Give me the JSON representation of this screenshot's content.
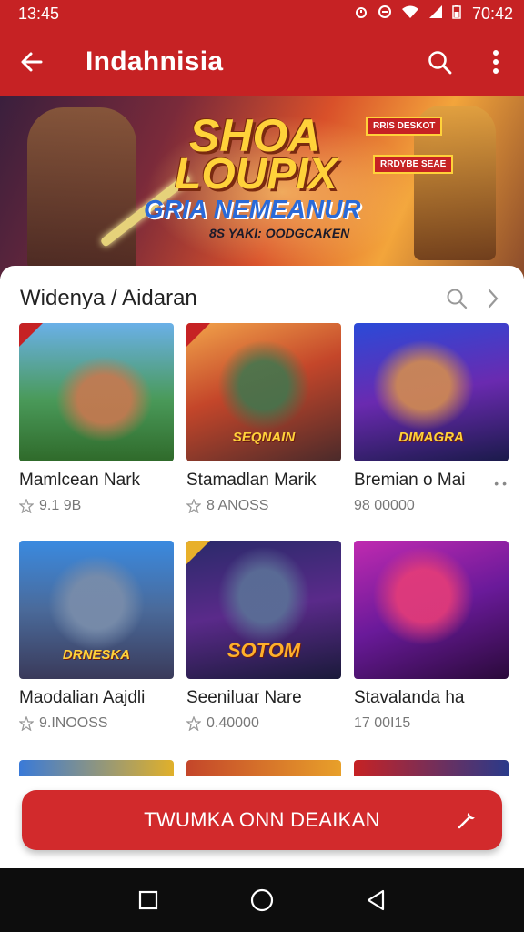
{
  "status_bar": {
    "time_left": "13:45",
    "time_right": "70:42",
    "icons": [
      "alarm-icon",
      "dnd-icon",
      "wifi-icon",
      "signal-icon",
      "battery-icon"
    ]
  },
  "app_bar": {
    "title": "Indahnisia",
    "back_icon": "arrow-left-icon",
    "search_icon": "search-icon",
    "menu_icon": "more-vert-icon"
  },
  "banner": {
    "title_line1": "SHOA",
    "title_line2": "LOUPIX",
    "subtitle": "GRIA NEMEANUR",
    "tagline": "8S YAKI: OODGCAKEN",
    "badge1": "RRIS DESKOT",
    "badge2": "RRDYBE SEAE"
  },
  "section": {
    "title": "Widenya / Aidaran",
    "search_icon": "search-icon",
    "next_icon": "chevron-right-icon"
  },
  "games": [
    {
      "name": "Mamlcean Nark",
      "rating": "9.1 9B",
      "logo": "",
      "art": "forest"
    },
    {
      "name": "Stamadlan Marik",
      "rating": "8 ANOSS",
      "logo": "SEQNAIN",
      "art": "city"
    },
    {
      "name": "Bremian o Mai",
      "rating": "98 00000",
      "logo": "DIMAGRA",
      "art": "space"
    },
    {
      "name": "Maodalian Aajdli",
      "rating": "9.INOOSS",
      "logo": "DRNESKA",
      "art": "castle"
    },
    {
      "name": "Seeniluar Nare",
      "rating": "0.40000",
      "logo": "SOTOM",
      "art": "night"
    },
    {
      "name": "Stavalanda ha",
      "rating": "17 00I15",
      "logo": "",
      "art": "neon"
    }
  ],
  "cta": {
    "label": "TWUMKA ONN DEAIKAN",
    "icon": "tools-icon"
  },
  "nav": {
    "recents_icon": "square-icon",
    "home_icon": "circle-icon",
    "back_icon": "triangle-back-icon"
  },
  "colors": {
    "primary": "#c62224",
    "cta": "#d22a2c",
    "nav_bg": "#0d0d0d"
  }
}
